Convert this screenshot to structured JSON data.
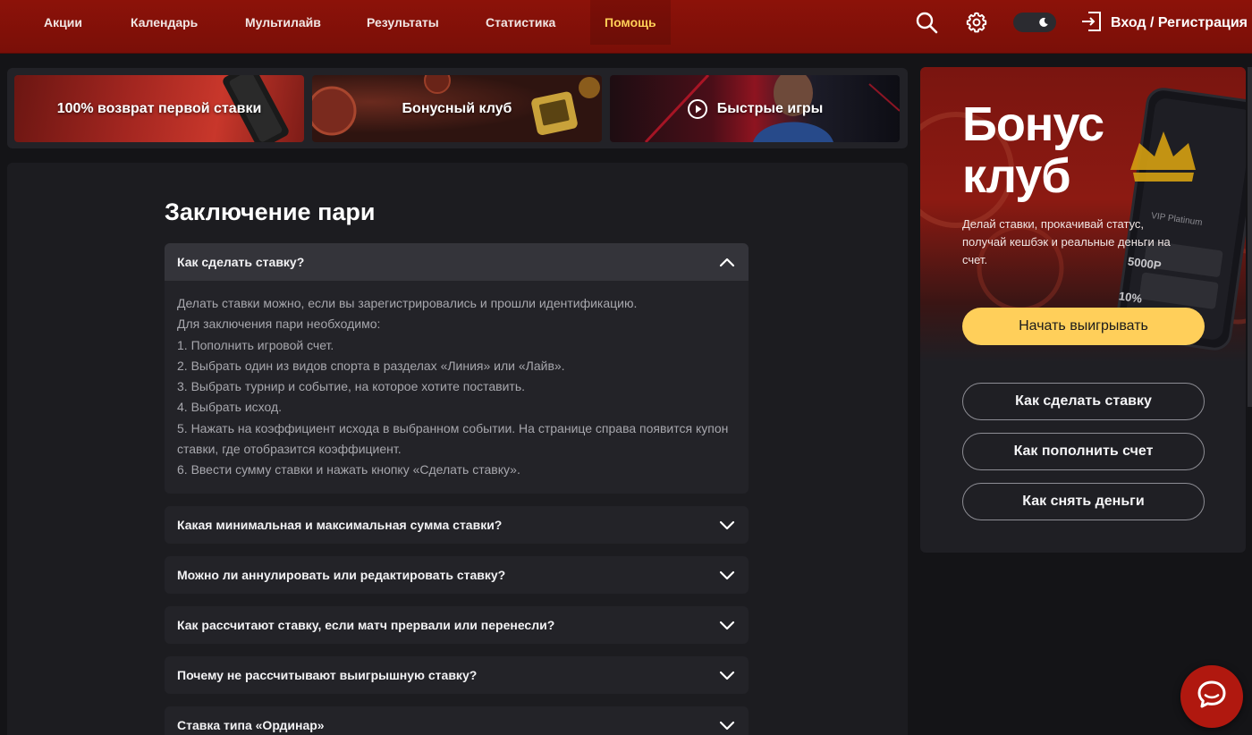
{
  "nav": {
    "items": [
      {
        "label": "Акции"
      },
      {
        "label": "Календарь"
      },
      {
        "label": "Мультилайв"
      },
      {
        "label": "Результаты"
      },
      {
        "label": "Статистика"
      },
      {
        "label": "Помощь",
        "active": true
      }
    ],
    "login_label": "Вход / Регистрация",
    "icons": [
      "search-icon",
      "gear-icon",
      "moon-icon",
      "login-icon"
    ]
  },
  "promos": [
    {
      "label": "100% возврат первой ставки"
    },
    {
      "label": "Бонусный клуб"
    },
    {
      "label": "Быстрые игры",
      "icon": "play-circle-icon"
    }
  ],
  "section": {
    "title": "Заключение пари"
  },
  "faq": [
    {
      "question": "Как сделать ставку?",
      "open": true,
      "answer_lines": [
        "Делать ставки можно, если вы зарегистрировались и прошли идентификацию.",
        "Для заключения пари необходимо:",
        "1. Пополнить игровой счет.",
        "2. Выбрать один из видов спорта в разделах «Линия» или «Лайв».",
        "3. Выбрать турнир и событие, на которое хотите поставить.",
        "4. Выбрать исход.",
        "5. Нажать на коэффициент исхода в выбранном событии. На странице справа появится купон ставки, где отобразится коэффициент.",
        "6. Ввести сумму ставки и нажать кнопку «Сделать ставку»."
      ]
    },
    {
      "question": "Какая минимальная и максимальная сумма ставки?"
    },
    {
      "question": "Можно ли аннулировать или редактировать ставку?"
    },
    {
      "question": "Как рассчитают ставку, если матч прервали или перенесли?"
    },
    {
      "question": "Почему не рассчитывают выигрышную ставку?"
    },
    {
      "question": "Ставка типа «Ординар»"
    }
  ],
  "side": {
    "title_line1": "Бонус",
    "title_line2": "клуб",
    "text": "Делай ставки, прокачивай статус, получай кешбэк и реальные деньги на счет.",
    "cta_label": "Начать выигрывать",
    "links": [
      {
        "label": "Как сделать ставку"
      },
      {
        "label": "Как пополнить счет"
      },
      {
        "label": "Как снять деньги"
      }
    ],
    "phone_texts": [
      "VIP Platinum",
      "5000Р",
      "10%"
    ]
  },
  "colors": {
    "topbar": "#8c1209",
    "accent": "#ffce57",
    "cta": "#ffcf5a",
    "background": "#141417",
    "card": "#1c1c20",
    "chat": "#b0180f"
  }
}
